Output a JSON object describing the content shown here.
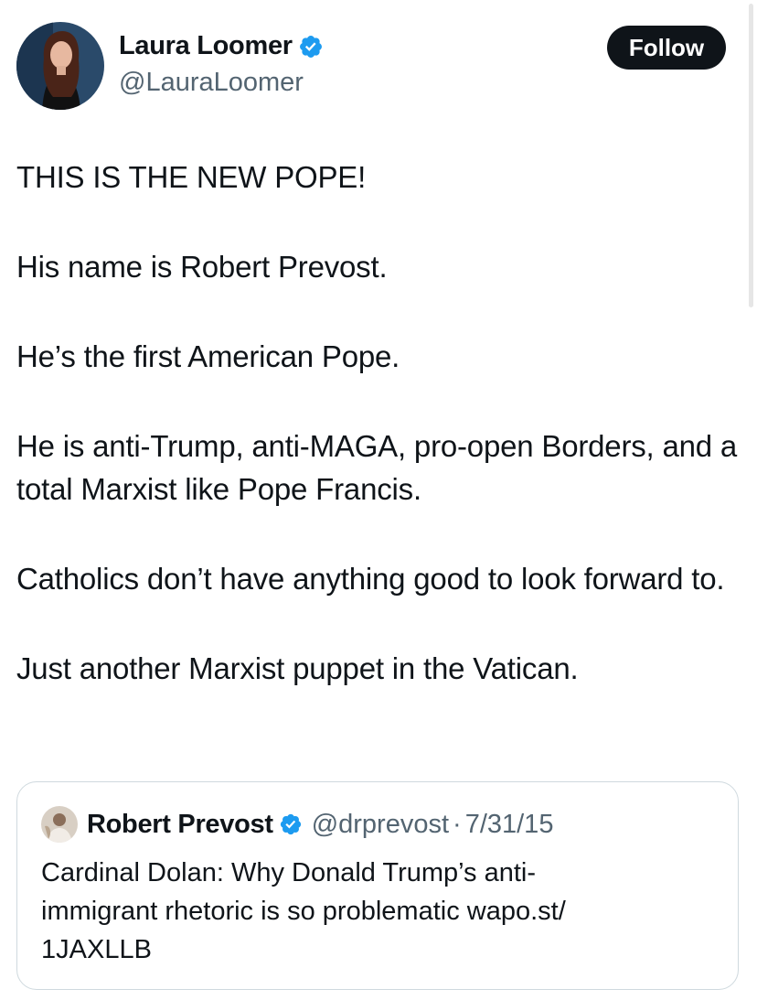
{
  "colors": {
    "text": "#0f1419",
    "secondary": "#536471",
    "verified": "#1d9bf0",
    "follow_bg": "#0f1419",
    "follow_text": "#ffffff",
    "border": "#cfd9de"
  },
  "tweet": {
    "author": {
      "name": "Laura Loomer",
      "handle": "@LauraLoomer",
      "verified_icon": "verified-badge-icon"
    },
    "follow_label": "Follow",
    "paragraphs": [
      "THIS IS THE NEW POPE!",
      "His name is Robert Prevost.",
      "He’s the first American Pope.",
      "He is anti-Trump, anti-MAGA, pro-open Borders, and a total Marxist like Pope Francis.",
      "Catholics don’t have anything good to look forward to.",
      "Just another Marxist puppet in the Vatican."
    ]
  },
  "quote": {
    "author": {
      "name": "Robert Prevost",
      "handle": "@drprevost",
      "separator": "·",
      "date": "7/31/15",
      "verified_icon": "verified-badge-icon"
    },
    "text_lines": [
      "Cardinal Dolan: Why Donald Trump’s anti-",
      "immigrant rhetoric is so problematic wapo.st/",
      "1JAXLLB"
    ]
  }
}
